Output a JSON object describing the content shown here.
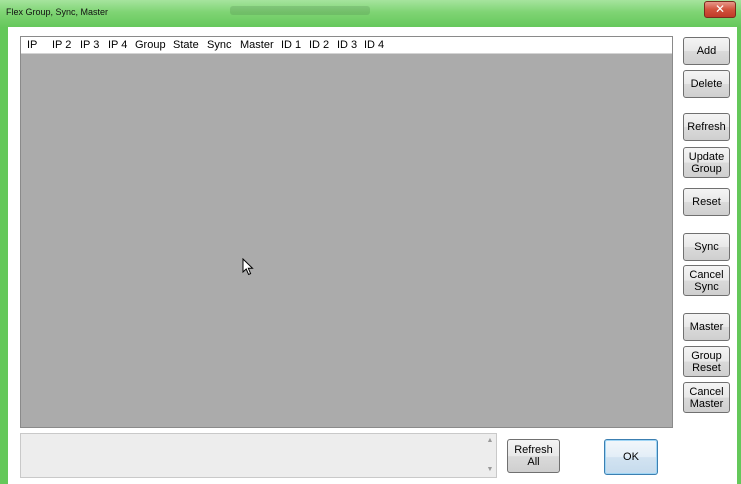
{
  "window": {
    "title": "Flex Group, Sync, Master",
    "close_label": "✕"
  },
  "list": {
    "columns": [
      "IP",
      "IP 2",
      "IP 3",
      "IP 4",
      "Group",
      "State",
      "Sync",
      "Master",
      "ID 1",
      "ID 2",
      "ID 3",
      "ID 4"
    ],
    "rows": []
  },
  "buttons": {
    "add": "Add",
    "delete": "Delete",
    "refresh": "Refresh",
    "update_group": "Update\nGroup",
    "reset": "Reset",
    "sync": "Sync",
    "cancel_sync": "Cancel\nSync",
    "master": "Master",
    "group_reset": "Group\nReset",
    "cancel_master": "Cancel\nMaster",
    "refresh_all": "Refresh\nAll",
    "ok": "OK"
  },
  "status": {
    "text": ""
  },
  "colors": {
    "window_frame": "#64c85a",
    "list_background": "#ababab",
    "close_button": "#c9422e"
  },
  "icons": {
    "close": "close-icon",
    "cursor": "mouse-pointer-icon",
    "scroll_up": "scroll-up-arrow-icon",
    "scroll_down": "scroll-down-arrow-icon"
  }
}
